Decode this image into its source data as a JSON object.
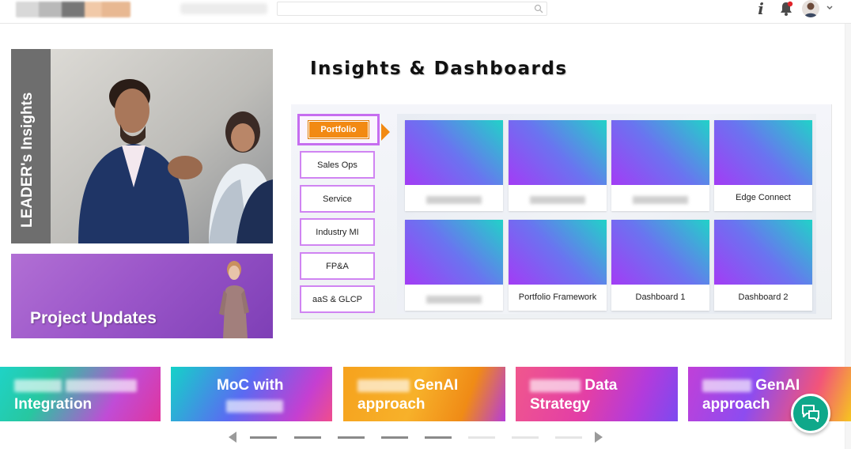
{
  "header": {
    "search": {
      "value": "",
      "placeholder": ""
    },
    "icons": [
      "info-icon",
      "bell-icon",
      "avatar",
      "chevron-down-icon"
    ],
    "notification_dot_color": "#e0242a"
  },
  "left": {
    "leader_card": {
      "title": "LEADER's Insights"
    },
    "project_card": {
      "title": "Project Updates"
    }
  },
  "insights": {
    "title": "Insights & Dashboards",
    "categories": [
      {
        "label": "Portfolio",
        "active": true
      },
      {
        "label": "Sales Ops",
        "active": false
      },
      {
        "label": "Service",
        "active": false
      },
      {
        "label": "Industry MI",
        "active": false
      },
      {
        "label": "FP&A",
        "active": false
      },
      {
        "label": "aaS & GLCP",
        "active": false
      }
    ],
    "tiles": [
      {
        "label": "",
        "redacted": true
      },
      {
        "label": "",
        "redacted": true
      },
      {
        "label": "",
        "redacted": true
      },
      {
        "label": "Edge Connect",
        "redacted": false
      },
      {
        "label": "",
        "redacted": true
      },
      {
        "label": "Portfolio Framework",
        "redacted": false
      },
      {
        "label": "Dashboard 1",
        "redacted": false
      },
      {
        "label": "Dashboard 2",
        "redacted": false
      }
    ],
    "accent_color": "#f28a13"
  },
  "bottom_tiles": [
    {
      "line1_visible": "",
      "line2": "Integration"
    },
    {
      "line1_visible": "MoC with",
      "line2": ""
    },
    {
      "line1_visible": "GenAI",
      "line2": "approach"
    },
    {
      "line1_visible": "Data",
      "line2": "Strategy"
    },
    {
      "line1_visible": "GenAI",
      "line2": "approach"
    }
  ],
  "carousel": {
    "pages": 8,
    "active_pages": 5
  }
}
